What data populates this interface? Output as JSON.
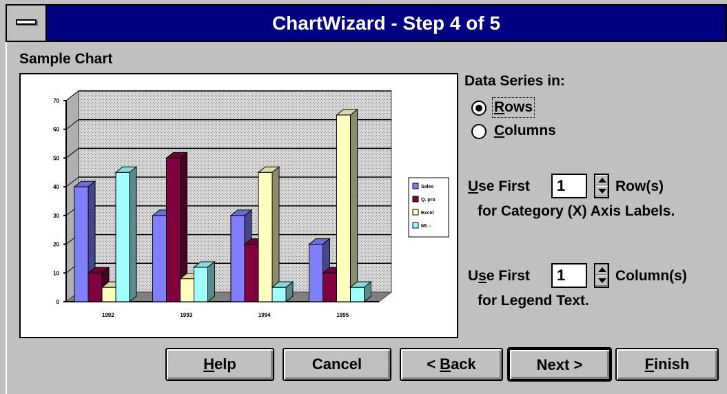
{
  "window": {
    "title": "ChartWizard - Step 4 of 5"
  },
  "sample_chart_label": "Sample Chart",
  "data_series": {
    "label": "Data Series in:",
    "options": [
      {
        "label": "Rows",
        "mnemonic": "R",
        "rest": "ows",
        "selected": true
      },
      {
        "label": "Columns",
        "mnemonic": "C",
        "rest": "olumns",
        "selected": false
      }
    ]
  },
  "category_axis": {
    "prefix_mnemonic": "U",
    "prefix_rest": "se First",
    "value": "1",
    "unit": "Row(s)",
    "description": "for Category (X) Axis Labels."
  },
  "legend_text": {
    "prefix_first": "U",
    "prefix_mnemonic": "s",
    "prefix_rest": "e First",
    "value": "1",
    "unit": "Column(s)",
    "description": "for Legend Text."
  },
  "buttons": {
    "help": {
      "mnemonic": "H",
      "rest": "elp"
    },
    "cancel": {
      "label": "Cancel"
    },
    "back": {
      "prefix": "< ",
      "mnemonic": "B",
      "rest": "ack"
    },
    "next": {
      "label": "Next >"
    },
    "finish": {
      "mnemonic": "F",
      "rest": "inish"
    }
  },
  "chart_data": {
    "type": "bar",
    "categories": [
      "1992",
      "1993",
      "1994",
      "1995"
    ],
    "series": [
      {
        "name": "Sales",
        "color": "#8080ff",
        "values": [
          40,
          30,
          30,
          20
        ]
      },
      {
        "name": "Q. pro",
        "color": "#800040",
        "values": [
          10,
          50,
          20,
          10
        ]
      },
      {
        "name": "Excel",
        "color": "#ffffc0",
        "values": [
          5,
          8,
          45,
          65
        ]
      },
      {
        "name": "Mt. -",
        "color": "#a0ffff",
        "values": [
          45,
          12,
          5,
          5
        ]
      }
    ],
    "ylim": [
      0,
      70
    ],
    "yticks": [
      "0",
      "10",
      "20",
      "30",
      "40",
      "50",
      "60",
      "70"
    ],
    "grid": true,
    "legend": "right"
  }
}
